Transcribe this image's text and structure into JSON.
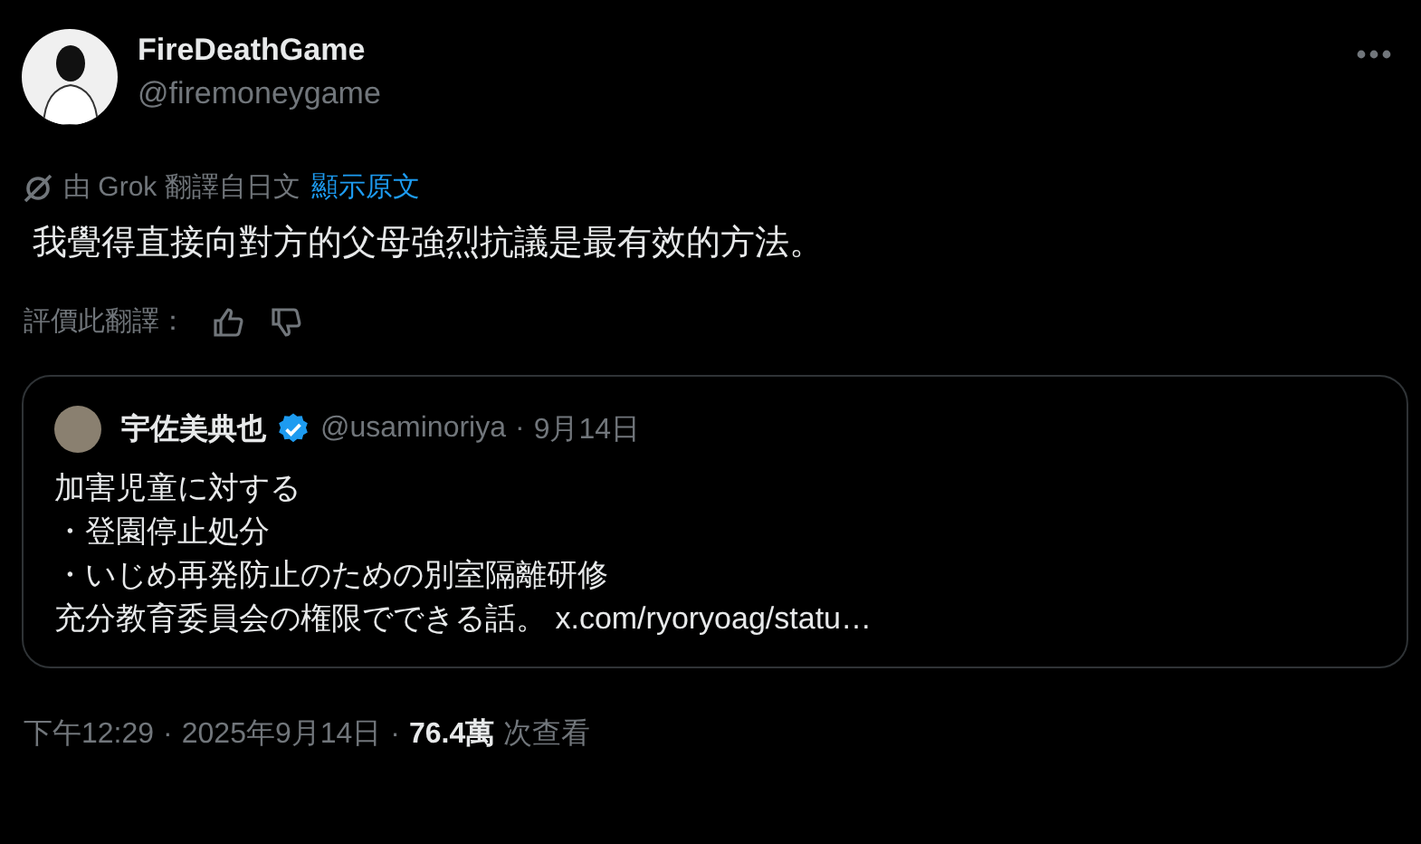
{
  "author": {
    "name": "FireDeathGame",
    "handle": "@firemoneygame"
  },
  "translation": {
    "note": "由 Grok 翻譯自日文",
    "link": "顯示原文"
  },
  "text": "我覺得直接向對方的父母強烈抗議是最有效的方法。",
  "rating": {
    "label": "評價此翻譯："
  },
  "quote": {
    "name": "宇佐美典也",
    "verified": true,
    "handle": "@usaminoriya",
    "separator": "·",
    "date": "9月14日",
    "lines": [
      "加害児童に対する",
      "・登園停止処分",
      "・いじめ再発防止のための別室隔離研修",
      "充分教育委員会の権限でできる話。 x.com/ryoryoag/statu…"
    ]
  },
  "footer": {
    "time": "下午12:29",
    "separator1": "·",
    "date": "2025年9月14日",
    "separator2": "·",
    "views": "76.4萬",
    "views_label": "次查看"
  }
}
